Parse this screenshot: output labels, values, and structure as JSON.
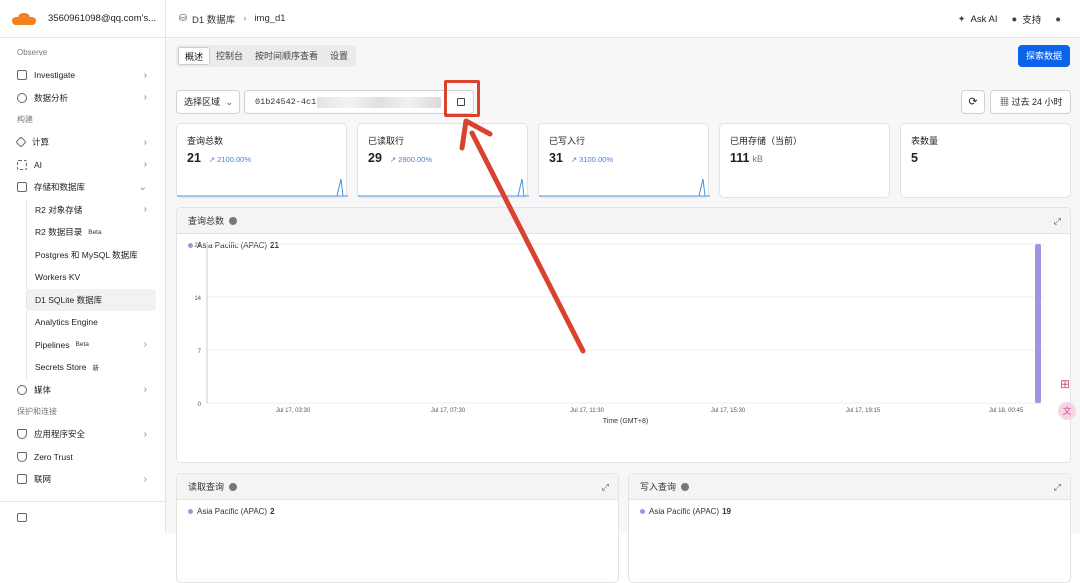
{
  "sidebar": {
    "account": "3560961098@qq.com's...",
    "sections": {
      "observe": "Observe",
      "build": "构建",
      "protect": "保护和连接"
    },
    "observe_items": [
      {
        "label": "Investigate"
      },
      {
        "label": "数据分析"
      }
    ],
    "build_items": [
      {
        "label": "计算"
      },
      {
        "label": "AI"
      },
      {
        "label": "存储和数据库"
      }
    ],
    "storage_sub": [
      {
        "label": "R2 对象存储",
        "badge": ""
      },
      {
        "label": "R2 数据目录",
        "badge": "Beta"
      },
      {
        "label": "Postgres 和 MySQL 数据库",
        "badge": ""
      },
      {
        "label": "Workers KV",
        "badge": ""
      },
      {
        "label": "D1 SQLite 数据库",
        "badge": ""
      },
      {
        "label": "Analytics Engine",
        "badge": ""
      },
      {
        "label": "Pipelines",
        "badge": "Beta"
      },
      {
        "label": "Secrets Store",
        "badge": "新"
      }
    ],
    "media": "媒体",
    "protect_items": [
      {
        "label": "应用程序安全"
      },
      {
        "label": "Zero Trust"
      },
      {
        "label": "联网"
      }
    ]
  },
  "topbar": {
    "crumb1": "D1 数据库",
    "crumb2": "img_d1",
    "ask_ai": "Ask AI",
    "support": "支持"
  },
  "tabs": [
    "概述",
    "控制台",
    "按时间顺序查看",
    "设置"
  ],
  "explore_button": "探索数据",
  "region_select": "选择区域",
  "database_id": "01b24542-4c1",
  "time_range": "过去 24 小时",
  "cards": [
    {
      "title": "查询总数",
      "value": "21",
      "change": "2100.00%"
    },
    {
      "title": "已读取行",
      "value": "29",
      "change": "2900.00%"
    },
    {
      "title": "已写入行",
      "value": "31",
      "change": "3100.00%"
    },
    {
      "title": "已用存储（当前）",
      "value": "111",
      "unit": "kB"
    },
    {
      "title": "表数量",
      "value": "5"
    }
  ],
  "main_chart": {
    "title": "查询总数",
    "legend": "Asia Pacific (APAC)",
    "legend_value": "21"
  },
  "chart_data": {
    "type": "bar",
    "xlabel": "Time (GMT+8)",
    "ylabel": "",
    "ylim": [
      0,
      21
    ],
    "yticks": [
      "0",
      "7",
      "14",
      "21"
    ],
    "xticks": [
      "Jul 17, 03:30",
      "Jul 17, 07:30",
      "Jul 17, 11:30",
      "Jul 17, 15:30",
      "Jul 17, 19:15",
      "Jul 18, 00:45"
    ],
    "series": [
      {
        "name": "Asia Pacific (APAC)",
        "x": [
          "Jul 18, 02:00"
        ],
        "values": [
          21
        ],
        "color": "#a593e0"
      }
    ]
  },
  "read_panel": {
    "title": "读取查询",
    "legend": "Asia Pacific (APAC)",
    "legend_value": "2"
  },
  "write_panel": {
    "title": "写入查询",
    "legend": "Asia Pacific (APAC)",
    "legend_value": "19"
  }
}
